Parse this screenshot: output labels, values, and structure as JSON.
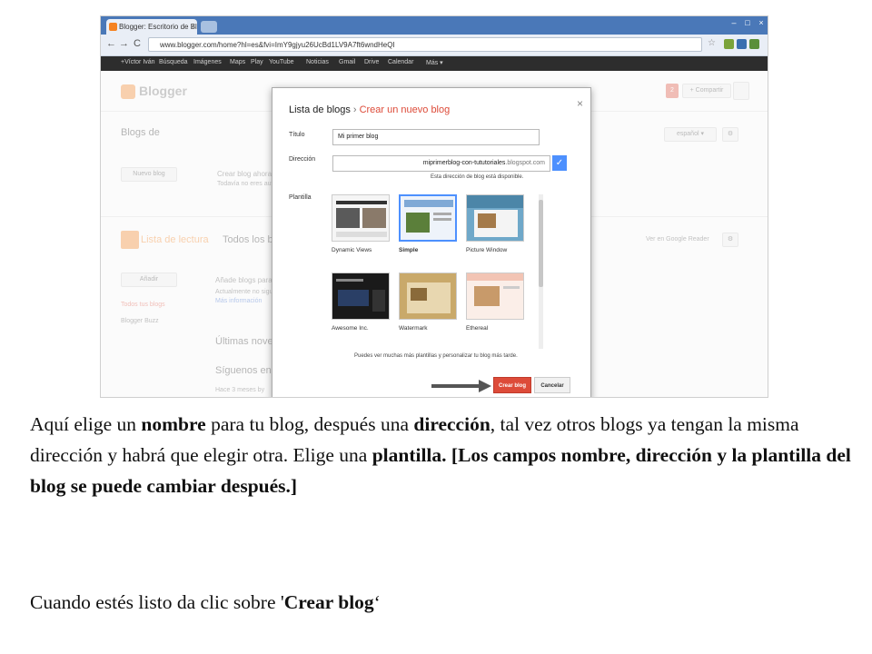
{
  "browser": {
    "tab_title": "Blogger: Escritorio de Blog",
    "tab_close": "×",
    "url": "www.blogger.com/home?hl=es&fvi=ImY9gjyu26UcBd1LV9A7ft6wndHeQI",
    "nav_back": "←",
    "nav_forward": "→",
    "nav_reload": "C",
    "win_min": "–",
    "win_max": "□",
    "win_close": "×"
  },
  "google_bar": {
    "items": [
      "+Víctor Iván",
      "Búsqueda",
      "Imágenes",
      "Maps",
      "Play",
      "YouTube",
      "Noticias",
      "Gmail",
      "Drive",
      "Calendar",
      "Más ▾"
    ]
  },
  "background": {
    "logo": "Blogger",
    "blogs_heading": "Blogs de",
    "new_blog_button": "Nuevo blog",
    "create_blog_now": "Crear blog ahora",
    "not_yet": "Todavía no eres autor de",
    "reading_list": "Lista de lectura",
    "all_blogs_tab": "Todos los blogs",
    "add_button": "Añadir",
    "add_blogs": "Añade blogs para",
    "currently": "Actualmente no sigues",
    "more_info": "Más información",
    "all_my_blogs": "Todos tus blogs",
    "blogger_buzz": "Blogger Buzz",
    "latest_news": "Últimas noved",
    "follow_us": "Síguenos en",
    "days_ago": "Hace 3 meses by",
    "language": "español ▾",
    "view_reader": "Ver en Google Reader",
    "notif_count": "2",
    "share_button": "+ Compartir"
  },
  "dialog": {
    "breadcrumb_root": "Lista de blogs",
    "breadcrumb_sep": "›",
    "breadcrumb_current": "Crear un nuevo blog",
    "close": "×",
    "title_label": "Título",
    "title_value": "Mi primer blog",
    "address_label": "Dirección",
    "address_value": "miprimerblog-con-tututoriales",
    "address_suffix": ".blogspot.com",
    "check": "✓",
    "address_available": "Esta dirección de blog está disponible.",
    "template_label": "Plantilla",
    "templates": [
      "Dynamic Views",
      "Simple",
      "Picture Window",
      "Awesome Inc.",
      "Watermark",
      "Ethereal"
    ],
    "more_templates_note": "Puedes ver muchas más plantillas y personalizar tu blog más tarde.",
    "create_button": "Crear blog",
    "cancel_button": "Cancelar"
  },
  "instructions": {
    "p1_a": "Aquí elige  un ",
    "p1_b": "nombre",
    "p1_c": " para tu blog, después una ",
    "p1_d": "dirección",
    "p1_e": ", tal vez otros blogs ya tengan la misma  dirección y habrá que elegir otra. Elige una ",
    "p1_f": "plantilla. [Los campos nombre, dirección y la plantilla del blog se puede cambiar después.]",
    "p2_a": "Cuando estés listo da clic sobre '",
    "p2_b": "Crear blog",
    "p2_c": "‘"
  },
  "colors": {
    "accent": "#dd4b39",
    "check": "#4d90fe",
    "tabbar": "#4a78b8"
  }
}
